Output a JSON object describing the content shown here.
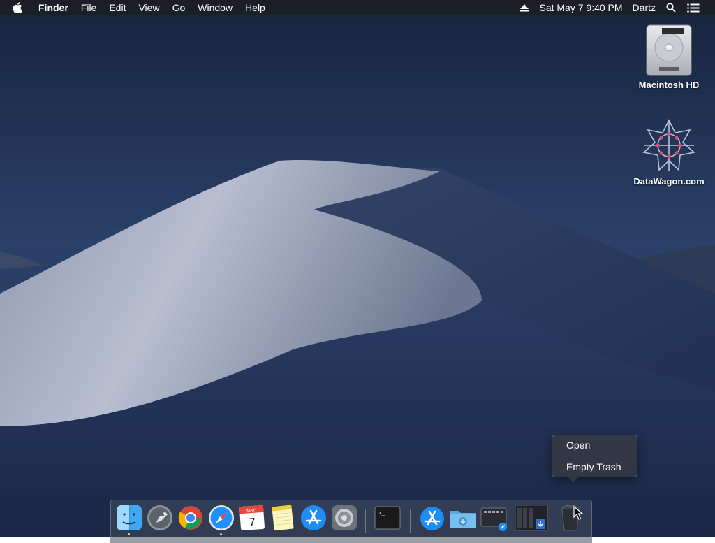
{
  "menubar": {
    "app_name": "Finder",
    "menus": [
      "File",
      "Edit",
      "View",
      "Go",
      "Window",
      "Help"
    ],
    "datetime": "Sat May 7  9:40 PM",
    "user": "Dartz"
  },
  "desktop_icons": [
    {
      "label": "Macintosh HD",
      "icon": "hard-drive-icon"
    },
    {
      "label": "DataWagon.com",
      "icon": "network-star-icon"
    }
  ],
  "context_menu": {
    "items": [
      "Open",
      "Empty Trash"
    ]
  },
  "dock": {
    "apps": [
      {
        "name": "Finder",
        "icon": "finder-icon",
        "running": true
      },
      {
        "name": "Launchpad",
        "icon": "launchpad-icon",
        "running": false
      },
      {
        "name": "Chrome",
        "icon": "chrome-icon",
        "running": false
      },
      {
        "name": "Safari",
        "icon": "safari-icon",
        "running": true
      },
      {
        "name": "Calendar",
        "icon": "calendar-icon",
        "running": false,
        "month": "MAY",
        "day": "7"
      },
      {
        "name": "Notes",
        "icon": "notes-icon",
        "running": false
      },
      {
        "name": "App Store",
        "icon": "app-store-icon",
        "running": false
      },
      {
        "name": "System Preferences",
        "icon": "system-preferences-icon",
        "running": false
      },
      {
        "name": "Terminal",
        "icon": "terminal-icon",
        "running": false,
        "prompt": ">_"
      },
      {
        "name": "Applications",
        "icon": "applications-stack-icon",
        "running": false
      },
      {
        "name": "Downloads",
        "icon": "downloads-folder-icon",
        "running": false
      },
      {
        "name": "Screenshots",
        "icon": "screenshot-stack-icon",
        "running": false
      },
      {
        "name": "Documents",
        "icon": "documents-stack-icon",
        "running": false
      },
      {
        "name": "Trash",
        "icon": "trash-icon",
        "running": false
      }
    ]
  },
  "colors": {
    "menubar_bg": "#1c1e24",
    "accent_blue": "#1e90ff"
  }
}
